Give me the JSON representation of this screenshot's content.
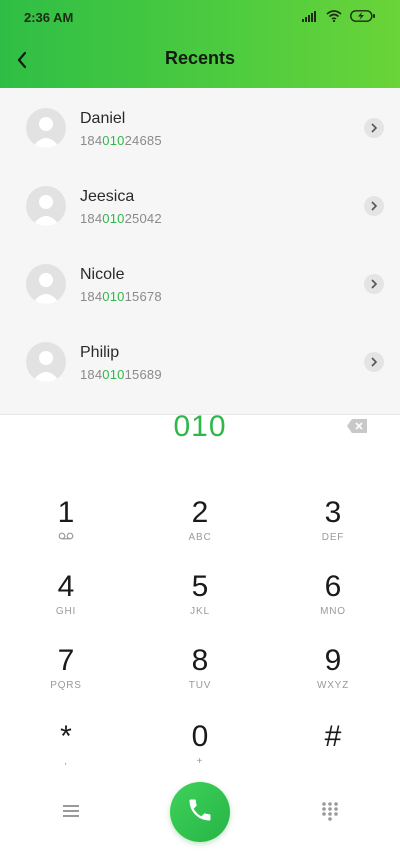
{
  "status": {
    "time": "2:36 AM",
    "icons": [
      "signal-icon",
      "wifi-icon",
      "battery-charging-icon"
    ]
  },
  "header": {
    "title": "Recents",
    "back_icon": "back-arrow-icon"
  },
  "colors": {
    "accent": "#2fb84a",
    "header_start": "#2fbe45",
    "header_end": "#6ad438",
    "list_bg": "#f6f6f6"
  },
  "contacts": [
    {
      "name": "Daniel",
      "number_prefix": "184",
      "number_match": "010",
      "number_suffix": "24685"
    },
    {
      "name": "Jeesica",
      "number_prefix": "184",
      "number_match": "010",
      "number_suffix": "25042"
    },
    {
      "name": "Nicole",
      "number_prefix": "184",
      "number_match": "010",
      "number_suffix": "15678"
    },
    {
      "name": "Philip",
      "number_prefix": "184",
      "number_match": "010",
      "number_suffix": "15689"
    }
  ],
  "dialer": {
    "entered": "010"
  },
  "keypad": [
    {
      "digit": "1",
      "letters": ""
    },
    {
      "digit": "2",
      "letters": "ABC"
    },
    {
      "digit": "3",
      "letters": "DEF"
    },
    {
      "digit": "4",
      "letters": "GHI"
    },
    {
      "digit": "5",
      "letters": "JKL"
    },
    {
      "digit": "6",
      "letters": "MNO"
    },
    {
      "digit": "7",
      "letters": "PQRS"
    },
    {
      "digit": "8",
      "letters": "TUV"
    },
    {
      "digit": "9",
      "letters": "WXYZ"
    },
    {
      "digit": "*",
      "letters": ","
    },
    {
      "digit": "0",
      "letters": "+"
    },
    {
      "digit": "#",
      "letters": ""
    }
  ],
  "bottom_bar": {
    "left_icon": "menu-icon",
    "center_icon": "phone-icon",
    "right_icon": "keypad-icon"
  }
}
